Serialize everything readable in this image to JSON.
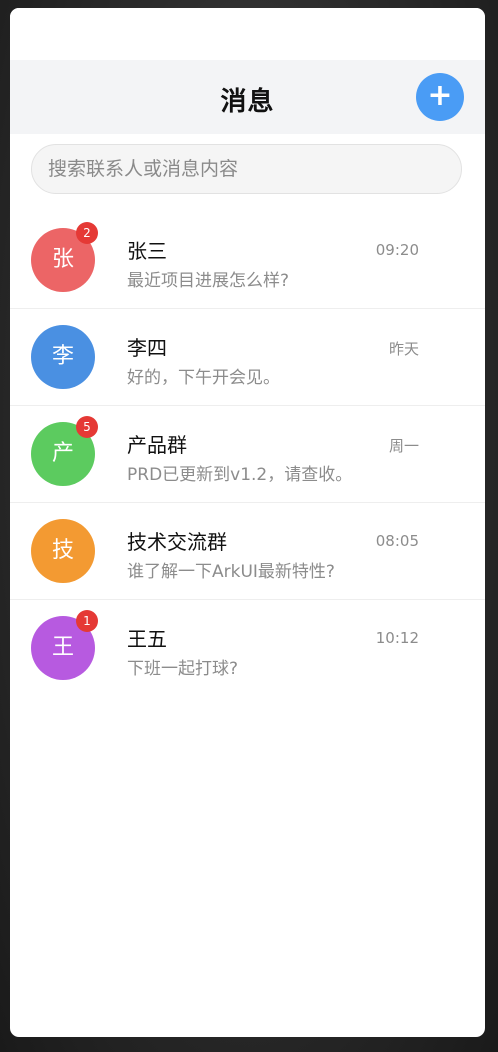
{
  "header": {
    "title": "消息",
    "add_label": "+"
  },
  "search": {
    "placeholder": "搜索联系人或消息内容"
  },
  "conversations": [
    {
      "avatar": "张",
      "name": "张三",
      "preview": "最近项目进展怎么样?",
      "time": "09:20",
      "unread": "2",
      "color": "#ec6566"
    },
    {
      "avatar": "李",
      "name": "李四",
      "preview": "好的，下午开会见。",
      "time": "昨天",
      "unread": "",
      "color": "#4a90e2"
    },
    {
      "avatar": "产",
      "name": "产品群",
      "preview": "PRD已更新到v1.2，请查收。",
      "time": "周一",
      "unread": "5",
      "color": "#5ccb5f"
    },
    {
      "avatar": "技",
      "name": "技术交流群",
      "preview": "谁了解一下ArkUI最新特性?",
      "time": "08:05",
      "unread": "",
      "color": "#f39a32"
    },
    {
      "avatar": "王",
      "name": "王五",
      "preview": "下班一起打球?",
      "time": "10:12",
      "unread": "1",
      "color": "#b75ae0"
    }
  ],
  "colors": {
    "accent": "#4a9cf5",
    "badge": "#e53935"
  }
}
